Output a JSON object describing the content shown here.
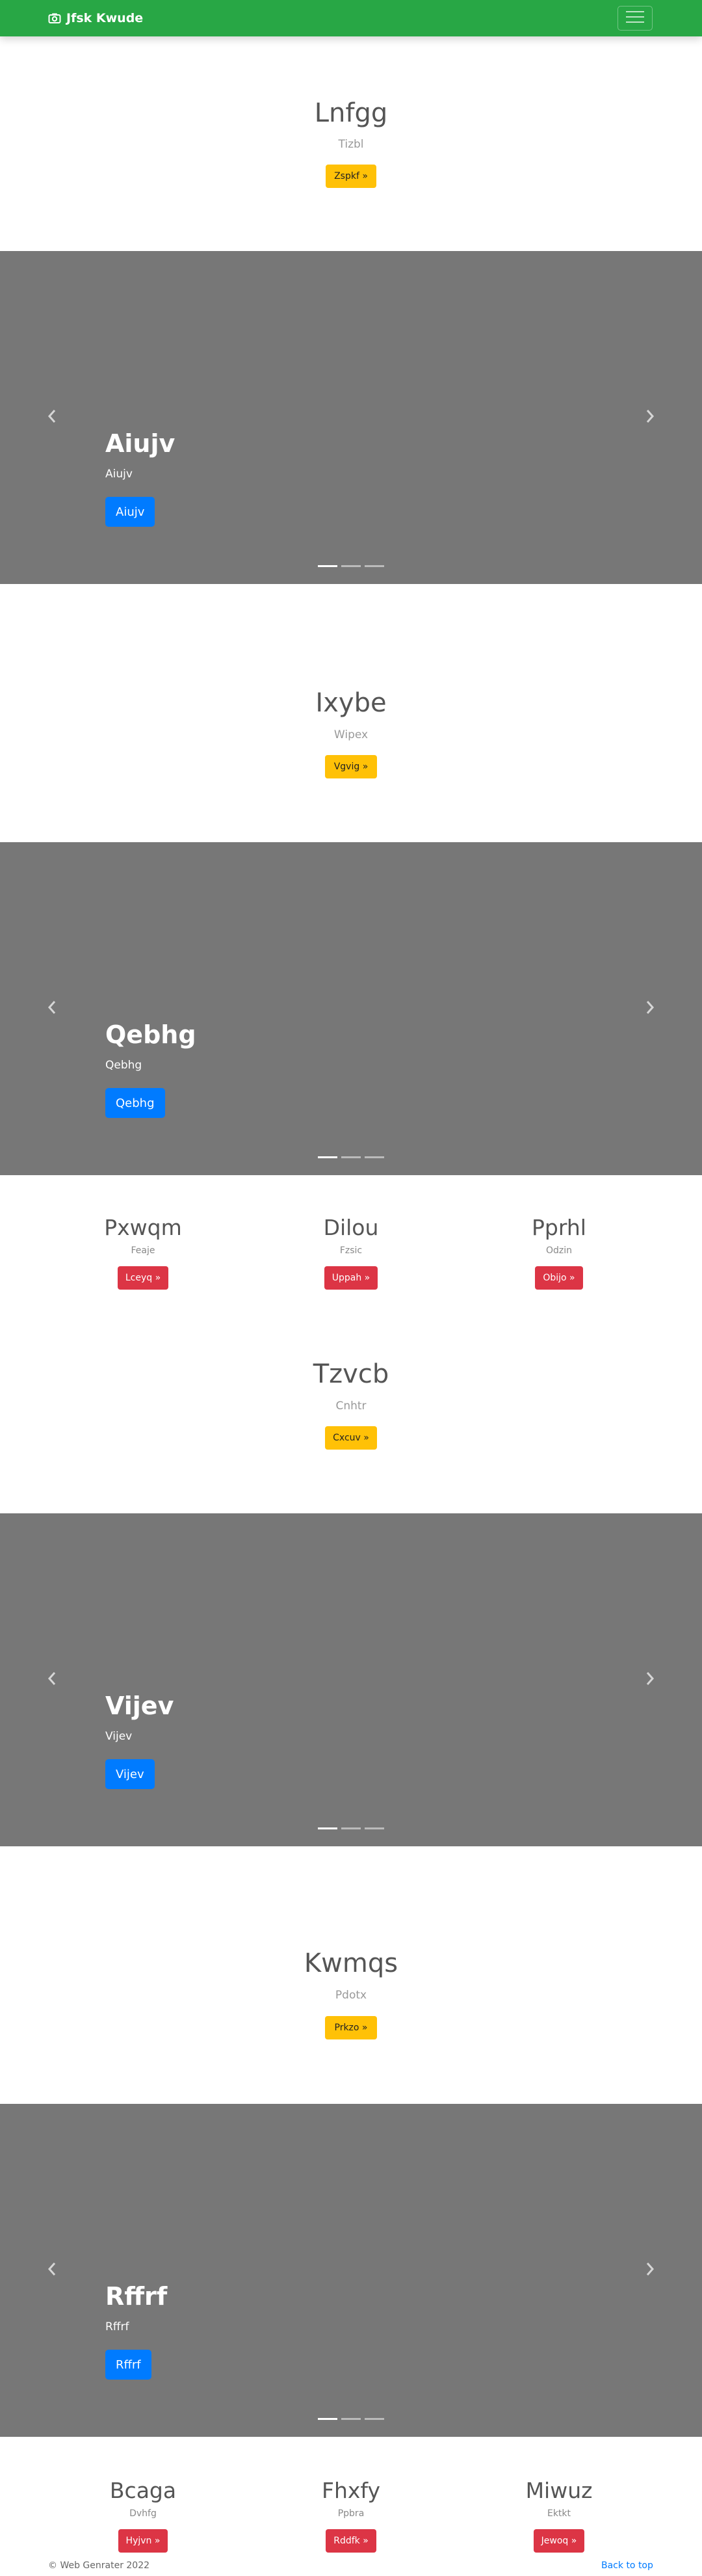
{
  "navbar": {
    "brand": "Jfsk Kwude",
    "brand_icon": "camera-icon",
    "toggler_icon": "hamburger-icon"
  },
  "hero1": {
    "title": "Lnfgg",
    "subtitle": "Tizbl",
    "button": "Zspkf »"
  },
  "carousel1": {
    "caption_title": "Aiujv",
    "caption_text": "Aiujv",
    "button": "Aiujv",
    "slides": 3,
    "active_slide": 1
  },
  "hero2": {
    "title": "Ixybe",
    "subtitle": "Wipex",
    "button": "Vgvig »"
  },
  "carousel2": {
    "caption_title": "Qebhg",
    "caption_text": "Qebhg",
    "button": "Qebhg",
    "slides": 3,
    "active_slide": 1
  },
  "columns1": [
    {
      "title": "Pxwqm",
      "subtitle": "Feaje",
      "button": "Lceyq »"
    },
    {
      "title": "Dilou",
      "subtitle": "Fzsic",
      "button": "Uppah »"
    },
    {
      "title": "Pprhl",
      "subtitle": "Odzin",
      "button": "Obijo »"
    }
  ],
  "hero3": {
    "title": "Tzvcb",
    "subtitle": "Cnhtr",
    "button": "Cxcuv »"
  },
  "carousel3": {
    "caption_title": "Vijev",
    "caption_text": "Vijev",
    "button": "Vijev",
    "slides": 3,
    "active_slide": 1
  },
  "hero4": {
    "title": "Kwmqs",
    "subtitle": "Pdotx",
    "button": "Prkzo »"
  },
  "carousel4": {
    "caption_title": "Rffrf",
    "caption_text": "Rffrf",
    "button": "Rffrf",
    "slides": 3,
    "active_slide": 1
  },
  "columns2": [
    {
      "title": "Bcaga",
      "subtitle": "Dvhfg",
      "button": "Hyjvn »"
    },
    {
      "title": "Fhxfy",
      "subtitle": "Ppbra",
      "button": "Rddfk »"
    },
    {
      "title": "Miwuz",
      "subtitle": "Ektkt",
      "button": "Jewoq »"
    }
  ],
  "footer": {
    "copyright": "© Web Genrater 2022",
    "back_to_top": "Back to top"
  },
  "colors": {
    "navbar": "#28a745",
    "carousel_bg": "#777777",
    "primary": "#007bff",
    "warning": "#ffc107",
    "danger": "#dc3545"
  }
}
